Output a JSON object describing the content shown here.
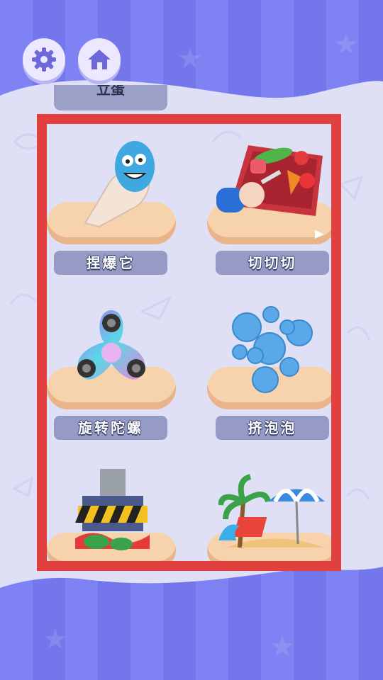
{
  "header": {
    "settings_icon": "gear-icon",
    "home_icon": "home-icon",
    "top_partial_label": "立蛋"
  },
  "games": [
    {
      "label": "捏爆它",
      "icon": "squeeze-monster-icon"
    },
    {
      "label": "切切切",
      "icon": "cutting-board-icon"
    },
    {
      "label": "旋转陀螺",
      "icon": "fidget-spinner-icon"
    },
    {
      "label": "挤泡泡",
      "icon": "bubbles-icon"
    },
    {
      "label": "",
      "icon": "hydraulic-press-icon"
    },
    {
      "label": "",
      "icon": "beach-icon"
    }
  ],
  "colors": {
    "background": "#7b7ef0",
    "panel": "#dfe0f6",
    "highlight_frame": "#e2403f",
    "label_bg": "#959bc5",
    "platform": "#f7d3ad"
  }
}
